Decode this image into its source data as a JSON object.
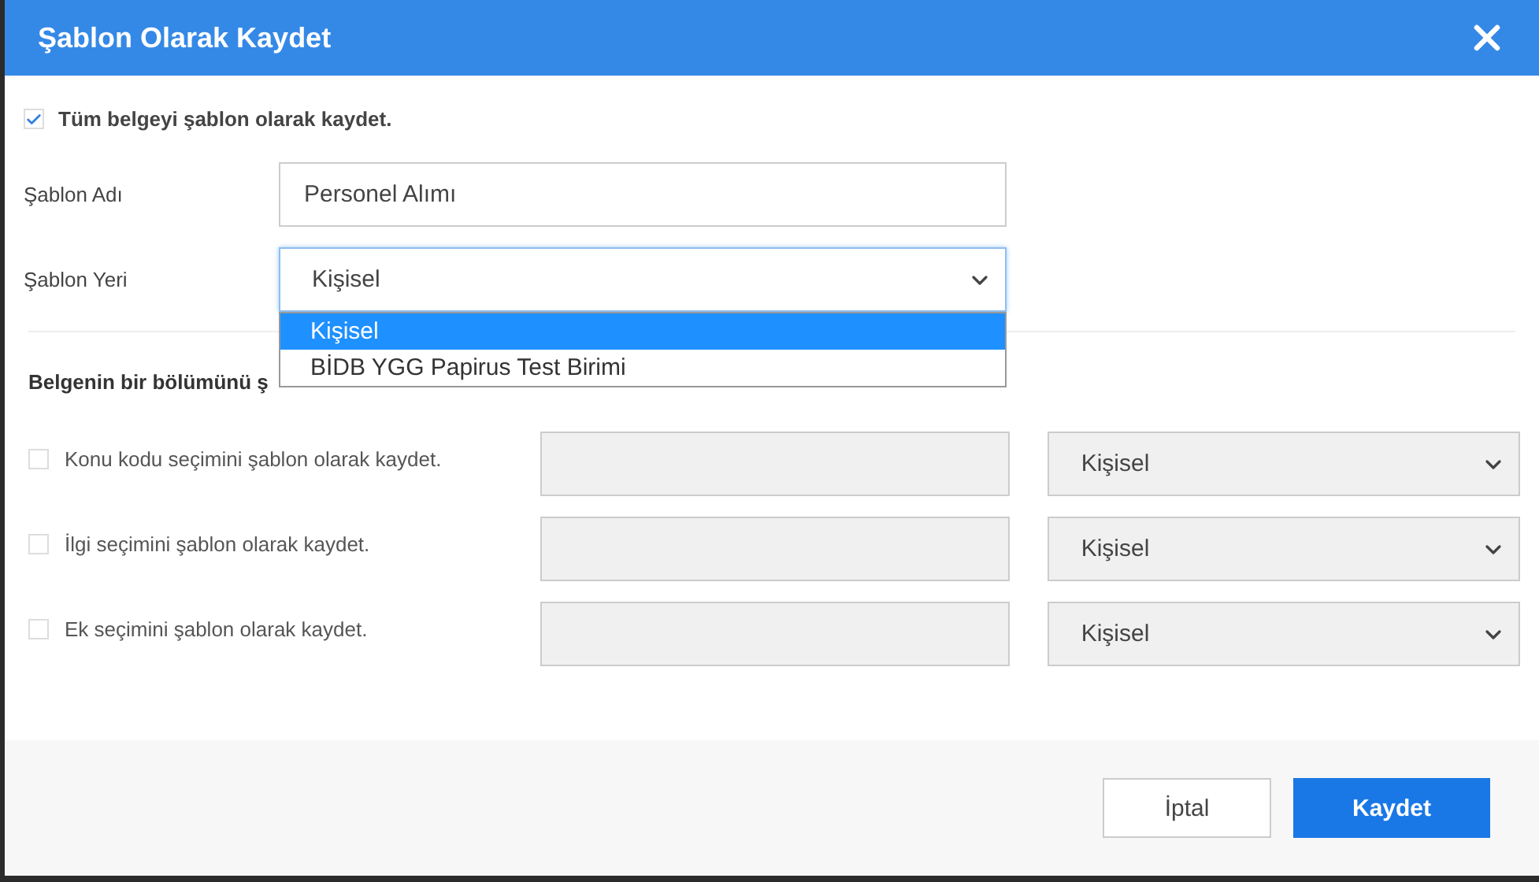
{
  "dialog": {
    "title": "Şablon Olarak Kaydet"
  },
  "whole_document": {
    "label": "Tüm belgeyi şablon olarak kaydet.",
    "checked": true
  },
  "template_name": {
    "label": "Şablon Adı",
    "value": "Personel Alımı"
  },
  "template_location": {
    "label": "Şablon Yeri",
    "value": "Kişisel",
    "expanded": true,
    "options": [
      {
        "label": "Kişisel",
        "selected": true
      },
      {
        "label": "BİDB YGG Papirus Test Birimi",
        "selected": false
      }
    ]
  },
  "section": {
    "heading": "Belgenin bir bölümünü ş"
  },
  "parts": [
    {
      "label": "Konu kodu seçimini şablon olarak kaydet.",
      "checked": false,
      "disabled": true,
      "location": "Kişisel"
    },
    {
      "label": "İlgi seçimini şablon olarak kaydet.",
      "checked": false,
      "disabled": true,
      "location": "Kişisel"
    },
    {
      "label": "Ek seçimini şablon olarak kaydet.",
      "checked": false,
      "disabled": true,
      "location": "Kişisel"
    }
  ],
  "buttons": [
    {
      "label": "İptal",
      "kind": "secondary"
    },
    {
      "label": "Kaydet",
      "kind": "primary"
    }
  ]
}
